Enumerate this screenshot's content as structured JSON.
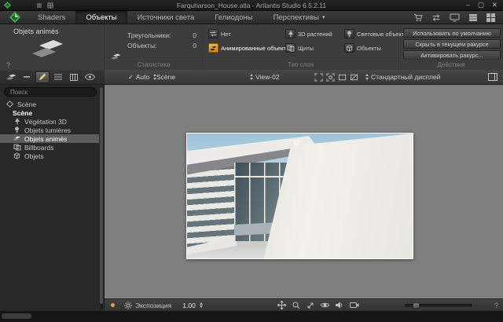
{
  "window": {
    "title": "Farquharson_House.atla - Artlantis Studio 6.5.2.11"
  },
  "icons": {
    "checkmark": "✓",
    "dropdown_caret": "▾",
    "minimize": "–",
    "maximize": "▢",
    "close": "✕"
  },
  "colors": {
    "accent_orange": "#e6a03a",
    "logo_green": "#45b24f",
    "selection_gray": "#5d5d5d",
    "viewport_gray": "#7e7e7e"
  },
  "tabbar": {
    "tabs": [
      {
        "label": "Shaders",
        "active": false
      },
      {
        "label": "Объекты",
        "active": true
      },
      {
        "label": "Источники света",
        "active": false
      },
      {
        "label": "Гелиодоны",
        "active": false
      },
      {
        "label": "Перспективы",
        "active": false
      }
    ]
  },
  "inspector": {
    "title": "Objets animés",
    "help": "?",
    "stats": {
      "section_label": "Статистика",
      "rows": [
        {
          "label": "Треугольники:",
          "value": "0"
        },
        {
          "label": "Объекты:",
          "value": "0"
        }
      ]
    },
    "layer_types": {
      "section_label": "Тип слоя",
      "options": [
        {
          "label": "Нет",
          "active": false
        },
        {
          "label": "Анимированные объекты",
          "active": true
        },
        {
          "label": "3D растений",
          "active": false
        },
        {
          "label": "Щиты",
          "active": false
        },
        {
          "label": "Световые объекты",
          "active": false
        },
        {
          "label": "Объекты",
          "active": false
        }
      ]
    },
    "actions": {
      "section_label": "Действия",
      "buttons": [
        {
          "label": "Использовать по умолчанию"
        },
        {
          "label": "Скрыть в текущем ракурсе"
        },
        {
          "label": "Активировать ракурс..."
        }
      ]
    }
  },
  "sidebar": {
    "search_placeholder": "Поиск",
    "tree": [
      {
        "label": "Scène",
        "selected": false
      },
      {
        "label": "Scène",
        "selected": false
      },
      {
        "label": "Végétation 3D",
        "selected": false
      },
      {
        "label": "Objets lumières",
        "selected": false
      },
      {
        "label": "Objets animés",
        "selected": true
      },
      {
        "label": "Billboards",
        "selected": false
      },
      {
        "label": "Objets",
        "selected": false
      }
    ]
  },
  "viewport_toolbar": {
    "auto_label": "Auto",
    "scene_dropdown": "Scène",
    "view_dropdown": "View-02",
    "display_dropdown": "Стандартный дисплей"
  },
  "bottombar": {
    "exposure_label": "Экспозиция",
    "exposure_value": "1.00",
    "help": "?"
  }
}
